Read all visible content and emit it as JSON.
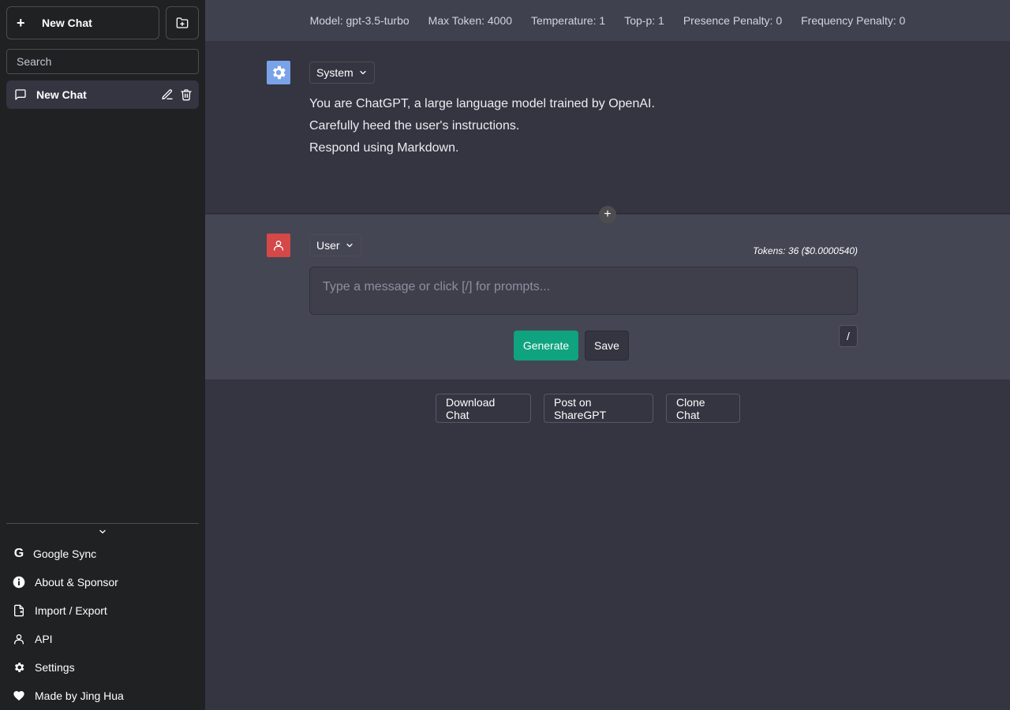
{
  "sidebar": {
    "new_chat_label": "New Chat",
    "search_placeholder": "Search",
    "chats": [
      {
        "label": "New Chat"
      }
    ],
    "menu": [
      {
        "label": "Google Sync",
        "icon": "google-icon"
      },
      {
        "label": "About & Sponsor",
        "icon": "info-icon"
      },
      {
        "label": "Import / Export",
        "icon": "file-export-icon"
      },
      {
        "label": "API",
        "icon": "person-icon"
      },
      {
        "label": "Settings",
        "icon": "gear-icon"
      },
      {
        "label": "Made by Jing Hua",
        "icon": "heart-icon"
      }
    ]
  },
  "config_bar": [
    "Model: gpt-3.5-turbo",
    "Max Token: 4000",
    "Temperature: 1",
    "Top-p: 1",
    "Presence Penalty: 0",
    "Frequency Penalty: 0"
  ],
  "system_message": {
    "role": "System",
    "lines": [
      "You are ChatGPT, a large language model trained by OpenAI.",
      "Carefully heed the user's instructions.",
      "Respond using Markdown."
    ]
  },
  "user_message": {
    "role": "User",
    "tokens": "Tokens: 36 ($0.0000540)",
    "placeholder": "Type a message or click [/] for prompts...",
    "generate_label": "Generate",
    "save_label": "Save",
    "slash_label": "/"
  },
  "bottom_actions": {
    "download": "Download Chat",
    "share": "Post on ShareGPT",
    "clone": "Clone Chat"
  },
  "colors": {
    "sidebar_bg": "#202123",
    "main_bg": "#343541",
    "user_section_bg": "#444654",
    "generate_button": "#10a37f",
    "system_avatar": "#7aa2e8",
    "user_avatar": "#d44848"
  }
}
